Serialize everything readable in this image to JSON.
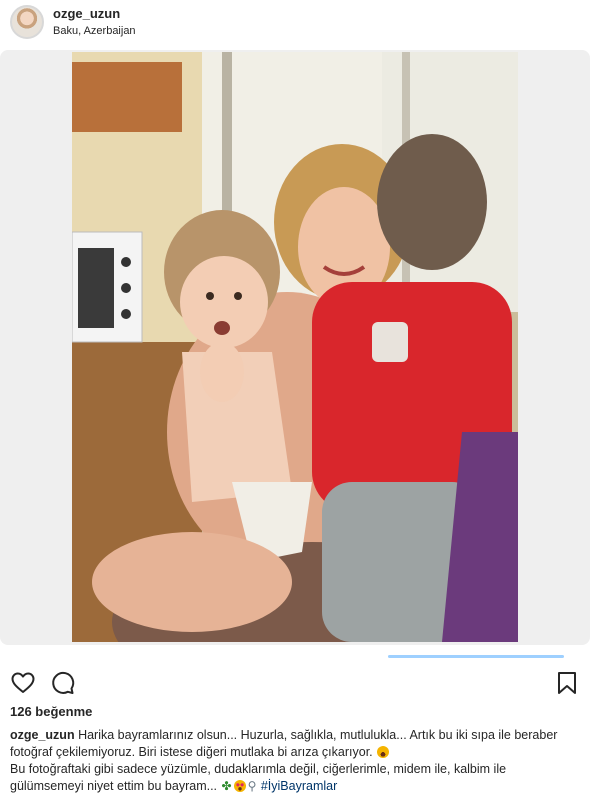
{
  "post": {
    "username": "ozge_uzun",
    "location": "Baku, Azerbaijan",
    "likes": "126 beğenme"
  },
  "actions": {
    "like_icon": "heart-icon",
    "comment_icon": "comment-icon",
    "save_icon": "bookmark-icon"
  },
  "caption": {
    "username": "ozge_uzun",
    "line1": " Harika bayramlarınız olsun... Huzurla, sağlıkla, mutlulukla... Artık bu iki sıpa ile beraber fotoğraf çekilemiyoruz. Biri istese diğeri mutlaka bi arıza çıkarıyor.",
    "line2": "Bu fotoğraftaki gibi sadece yüzümle, dudaklarımla değil, ciğerlerimle, midem ile, kalbim ile gülümsemeyi niyet ettim bu bayram...",
    "clover_glyph": "✤",
    "lens_glyph": "⚲",
    "hashtag": "#İyiBayramlar"
  },
  "colors": {
    "accent": "#003569",
    "text": "#262626",
    "progress": "#9ed0ff"
  }
}
